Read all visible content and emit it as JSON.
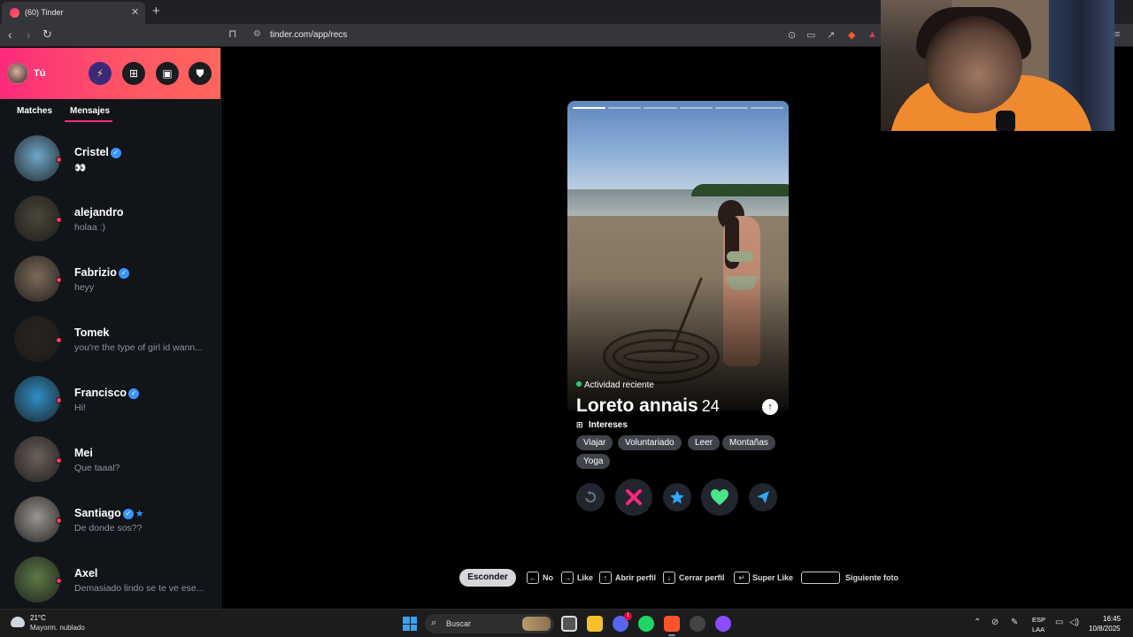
{
  "browser": {
    "tab_title": "(60) Tinder",
    "new_tab_icon": "+",
    "url": "tinder.com/app/recs"
  },
  "sidebar": {
    "me_label": "Tú",
    "tabs": [
      "Matches",
      "Mensajes"
    ],
    "active_tab": "Mensajes",
    "conversations": [
      {
        "name": "Cristel",
        "verified": true,
        "super": false,
        "message": "👀",
        "avatar_color": "#6fa9c9"
      },
      {
        "name": "alejandro",
        "verified": false,
        "super": false,
        "message": "holaa :)",
        "avatar_color": "#4a4536"
      },
      {
        "name": "Fabrizio",
        "verified": true,
        "super": false,
        "message": "heyy",
        "avatar_color": "#7c6b58"
      },
      {
        "name": "Tomek",
        "verified": false,
        "super": false,
        "message": "you're the type of girl id wann...",
        "avatar_color": "#2a2420"
      },
      {
        "name": "Francisco",
        "verified": true,
        "super": false,
        "message": "Hi!",
        "avatar_color": "#2f8fc7"
      },
      {
        "name": "Mei",
        "verified": false,
        "super": false,
        "message": "Que taaal?",
        "avatar_color": "#6b5f5a"
      },
      {
        "name": "Santiago",
        "verified": true,
        "super": true,
        "message": "De donde sos??",
        "avatar_color": "#9a9590"
      },
      {
        "name": "Axel",
        "verified": false,
        "super": false,
        "message": "Demasiado lindo se te ve ese...",
        "avatar_color": "#5d7a45"
      }
    ]
  },
  "profile": {
    "activity": "Actividad reciente",
    "name": "Loreto annais",
    "age": "24",
    "interests_label": "Intereses",
    "interests": [
      "Viajar",
      "Voluntariado",
      "Leer",
      "Montañas",
      "Yoga"
    ],
    "photo_count": 6,
    "active_photo": 1
  },
  "shortcuts": {
    "hide": "Esconder",
    "no": "No",
    "like": "Like",
    "open_profile": "Abrir perfil",
    "close_profile": "Cerrar perfil",
    "super_like": "Super Like",
    "next_photo": "Siguiente foto"
  },
  "taskbar": {
    "weather_temp": "21°C",
    "weather_desc": "Mayorm. nublado",
    "search_placeholder": "Buscar",
    "discord_badge": "1",
    "lang_top": "ESP",
    "lang_bottom": "LAA",
    "time": "16:45",
    "date": "10/8/2025"
  },
  "colors": {
    "brand_gradient_start": "#fd2a7b",
    "brand_gradient_end": "#ff655b",
    "nope": "#fd267a",
    "super_like": "#2fa8ff",
    "like": "#48e58a",
    "boost": "#b43cff",
    "verified": "#3a95ff"
  }
}
